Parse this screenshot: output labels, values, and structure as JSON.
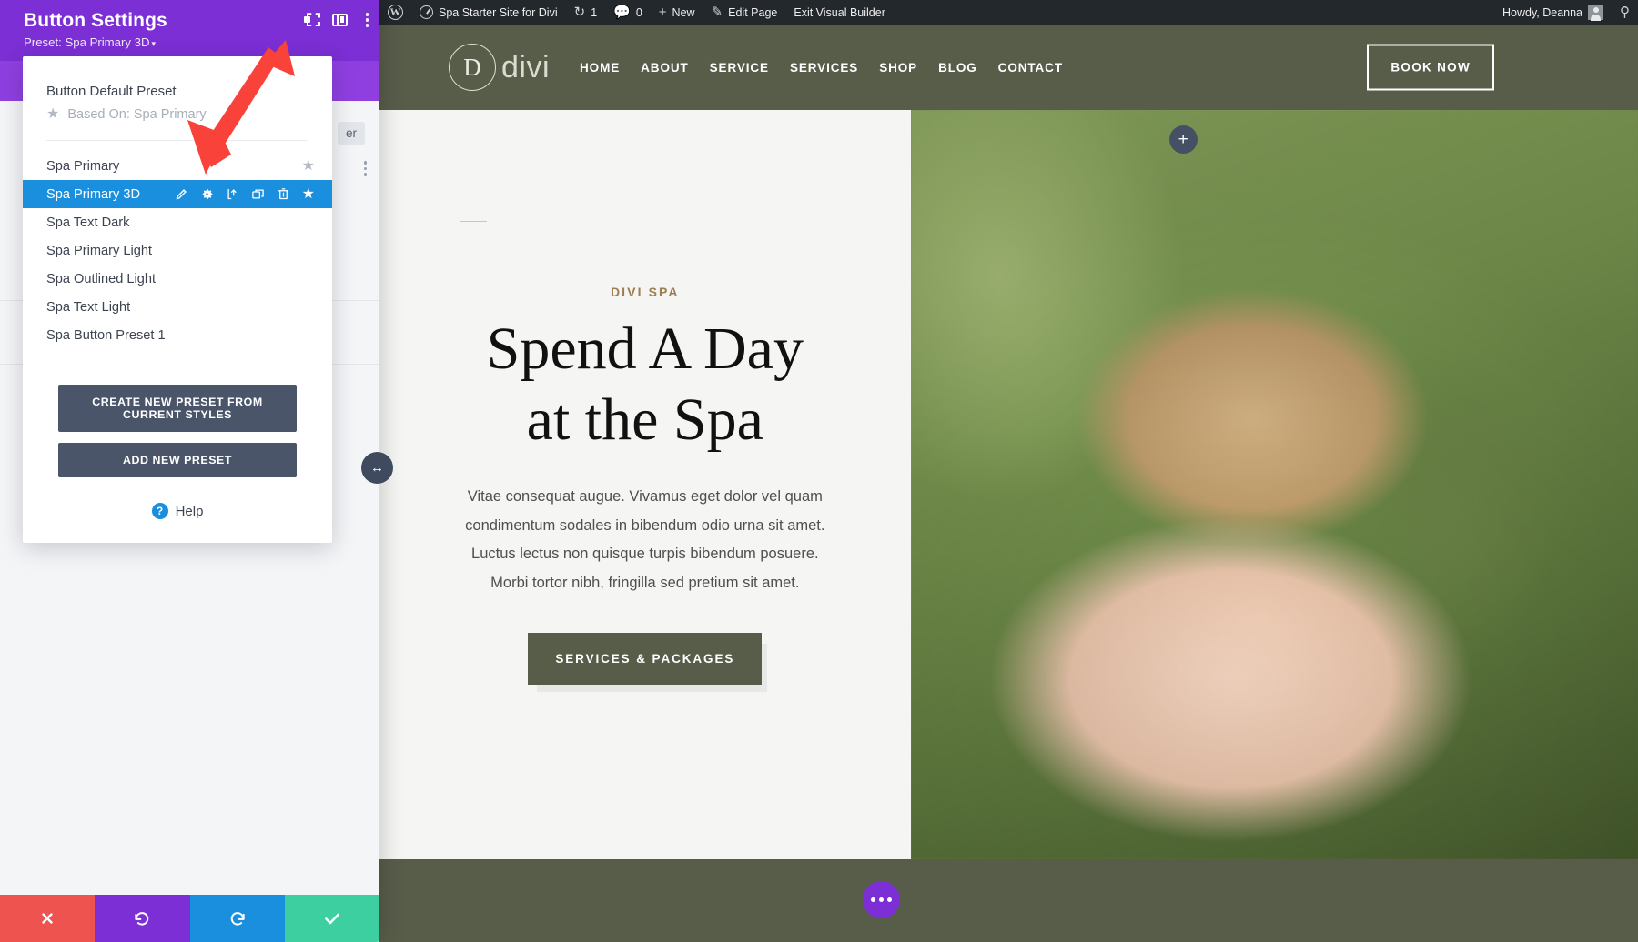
{
  "admin_bar": {
    "wp_logo": "wordpress-logo-icon",
    "site_name": "Spa Starter Site for Divi",
    "revisions_count": "1",
    "comments_count": "0",
    "new_label": "New",
    "edit_page_label": "Edit Page",
    "exit_builder_label": "Exit Visual Builder",
    "howdy": "Howdy, Deanna",
    "search_icon": "search-icon"
  },
  "site_header": {
    "brand_mark": "D",
    "brand_word": "divi",
    "nav": [
      "HOME",
      "ABOUT",
      "SERVICE",
      "SERVICES",
      "SHOP",
      "BLOG",
      "CONTACT"
    ],
    "cta": "BOOK NOW"
  },
  "hero": {
    "eyebrow": "DIVI SPA",
    "title_line1": "Spend A Day",
    "title_line2": "at the Spa",
    "body": "Vitae consequat augue. Vivamus eget dolor vel quam condimentum sodales in bibendum odio urna sit amet. Luctus lectus non quisque turpis bibendum posuere. Morbi tortor nibh, fringilla sed pretium sit amet.",
    "cta": "SERVICES & PACKAGES",
    "add_module": "+"
  },
  "panel": {
    "title": "Button Settings",
    "preset_label": "Preset: Spa Primary 3D",
    "caret": "▾",
    "header_icons": [
      "focus-frame-icon",
      "layout-columns-icon",
      "vertical-dots-icon"
    ],
    "ghost_tab": "er"
  },
  "preset_dropdown": {
    "default_preset_title": "Button Default Preset",
    "based_on_label": "Based On: Spa Primary",
    "items": [
      {
        "label": "Spa Primary",
        "selected": false,
        "starred": true
      },
      {
        "label": "Spa Primary 3D",
        "selected": true,
        "starred": true
      },
      {
        "label": "Spa Text Dark",
        "selected": false,
        "starred": false
      },
      {
        "label": "Spa Primary Light",
        "selected": false,
        "starred": false
      },
      {
        "label": "Spa Outlined Light",
        "selected": false,
        "starred": false
      },
      {
        "label": "Spa Text Light",
        "selected": false,
        "starred": false
      },
      {
        "label": "Spa Button Preset 1",
        "selected": false,
        "starred": false
      }
    ],
    "row_actions": [
      "pencil-icon",
      "gear-icon",
      "export-icon",
      "duplicate-icon",
      "trash-icon",
      "star-icon"
    ],
    "create_preset_btn": "CREATE NEW PRESET FROM CURRENT STYLES",
    "add_preset_btn": "ADD NEW PRESET",
    "help_label": "Help",
    "help_icon": "question-mark-icon"
  },
  "panel_actions": {
    "cancel": "close-icon",
    "undo": "undo-icon",
    "redo": "redo-icon",
    "save": "checkmark-icon"
  },
  "floating": {
    "drag_handle": "horizontal-resize-icon",
    "more_fab": "ellipsis-icon"
  },
  "colors": {
    "divi_purple": "#7b2fd4",
    "selected_blue": "#1a8fdd",
    "spa_green": "#585d4a",
    "eyebrow_gold": "#9d7e52",
    "action_red": "#ef5350",
    "action_teal": "#3ecfa0",
    "callout_red": "#f9423a",
    "dark_slate": "#4b5569"
  }
}
